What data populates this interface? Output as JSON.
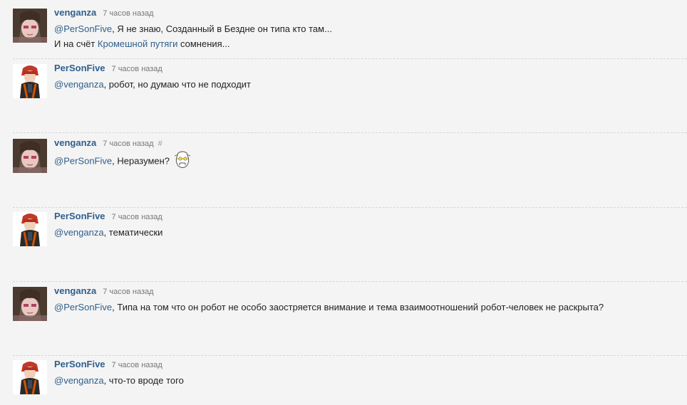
{
  "comments": [
    {
      "author": "venganza",
      "time": "7 часов назад",
      "avatar": "venganza-avatar",
      "mention": "@PerSonFive",
      "line1_text": ", Я не знаю, Созданный в Бездне он типа кто там...",
      "line2_pre": "И на счёт ",
      "line2_link": "Кромешной путяги",
      "line2_post": " сомнения..."
    },
    {
      "author": "PerSonFive",
      "time": "7 часов назад",
      "avatar": "personfive-avatar",
      "mention": "@venganza",
      "text": ", робот, но думаю что не подходит"
    },
    {
      "author": "venganza",
      "time": "7 часов назад",
      "hash": "#",
      "avatar": "venganza-avatar",
      "mention": "@PerSonFive",
      "text": ", Неразумен?",
      "emoji": "robot-face-emoji"
    },
    {
      "author": "PerSonFive",
      "time": "7 часов назад",
      "avatar": "personfive-avatar",
      "mention": "@venganza",
      "text": ", тематически"
    },
    {
      "author": "venganza",
      "time": "7 часов назад",
      "avatar": "venganza-avatar",
      "mention": "@PerSonFive",
      "text": ", Типа на том что он робот не особо заостряется внимание и тема взаимоотношений робот-человек не раскрыта?"
    },
    {
      "author": "PerSonFive",
      "time": "7 часов назад",
      "avatar": "personfive-avatar",
      "mention": "@venganza",
      "text": ", что-то вроде того"
    }
  ],
  "colors": {
    "background": "#f4f4f4",
    "author": "#2f5f8c",
    "link": "#2f5f8c",
    "time": "#777777"
  }
}
